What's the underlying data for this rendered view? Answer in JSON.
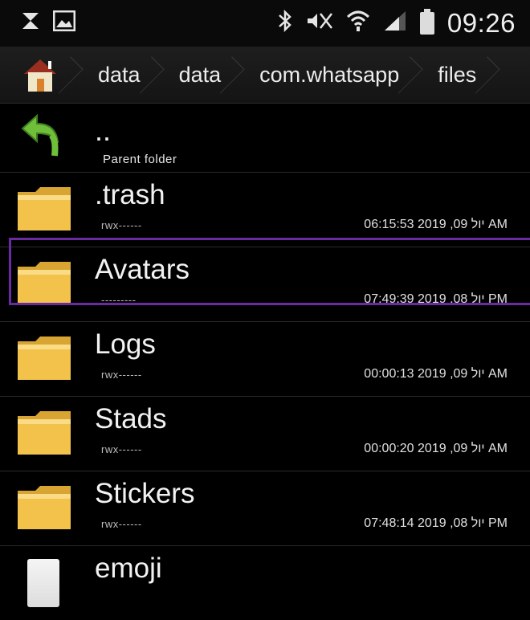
{
  "status_bar": {
    "time": "09:26",
    "left_icons": [
      "usb-debug-icon",
      "image-notification-icon"
    ],
    "right_icons": [
      "bluetooth-icon",
      "mute-icon",
      "wifi-icon",
      "signal-icon",
      "battery-icon"
    ]
  },
  "breadcrumb": {
    "home_icon": "home-icon",
    "items": [
      "data",
      "data",
      "com.whatsapp",
      "files"
    ]
  },
  "parent": {
    "name": "..",
    "label": "Parent folder"
  },
  "files": [
    {
      "name": ".trash",
      "perm": "rwx------",
      "date": "יול 09, 2019 06:15:53 AM",
      "type": "folder"
    },
    {
      "name": "Avatars",
      "perm": "---------",
      "date": "יול 08, 2019 07:49:39 PM",
      "type": "folder",
      "selected": true
    },
    {
      "name": "Logs",
      "perm": "rwx------",
      "date": "יול 09, 2019 00:00:13 AM",
      "type": "folder"
    },
    {
      "name": "Stads",
      "perm": "rwx------",
      "date": "יול 09, 2019 00:00:20 AM",
      "type": "folder"
    },
    {
      "name": "Stickers",
      "perm": "rwx------",
      "date": "יול 08, 2019 07:48:14 PM",
      "type": "folder"
    },
    {
      "name": "emoji",
      "perm": "",
      "date": "",
      "type": "file"
    }
  ],
  "colors": {
    "background": "#000000",
    "folder": "#f3c24a",
    "selection": "#6a2aa0",
    "back_arrow": "#6fbf3a"
  }
}
